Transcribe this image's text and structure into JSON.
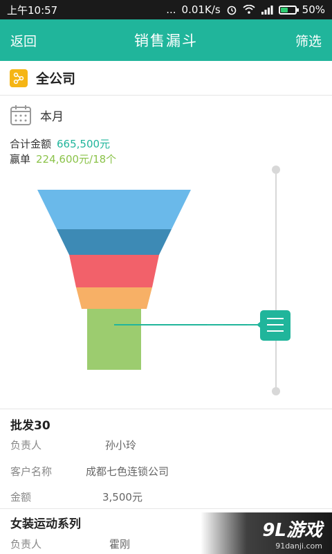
{
  "status_bar": {
    "time": "上午10:57",
    "signal_text": "...",
    "net_speed": "0.01K/s",
    "battery": "50%",
    "battery_level": 0.5
  },
  "header": {
    "back": "返回",
    "title": "销售漏斗",
    "filter": "筛选"
  },
  "company": {
    "name": "全公司"
  },
  "period": {
    "label": "本月"
  },
  "summary": {
    "total_label": "合计金额",
    "total_value": "665,500元",
    "won_label": "赢单",
    "won_value": "224,600元/18个"
  },
  "funnel": {
    "stages": [
      {
        "color": "#6ab9ea"
      },
      {
        "color": "#3d8ab5"
      },
      {
        "color": "#f2616a"
      },
      {
        "color": "#f7b066"
      },
      {
        "color": "#9ccc6f"
      }
    ],
    "selected_stage": 5
  },
  "items": [
    {
      "title": "批发30",
      "owner_label": "负责人",
      "owner": "孙小玲",
      "customer_label": "客户名称",
      "customer": "成都七色连锁公司",
      "amount_label": "金额",
      "amount": "3,500元"
    },
    {
      "title": "女装运动系列",
      "owner_label": "负责人",
      "owner": "霍刚"
    }
  ],
  "watermark": {
    "logo": "9L游戏",
    "url": "91danji.com"
  },
  "colors": {
    "accent": "#20b59b",
    "company_badge": "#f5b515"
  }
}
